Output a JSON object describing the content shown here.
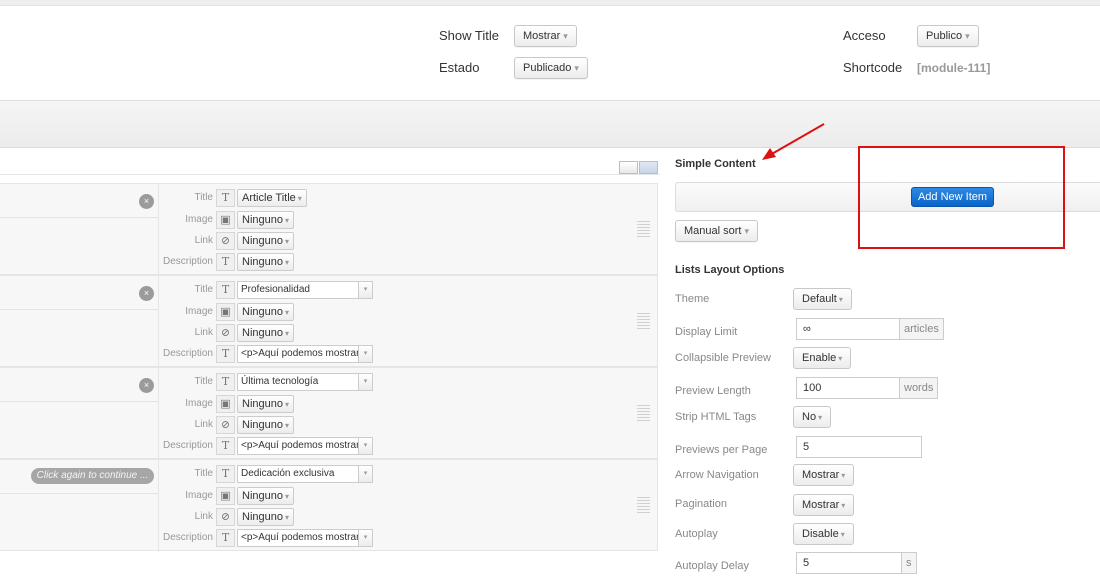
{
  "header": {
    "show_title_label": "Show Title",
    "show_title_value": "Mostrar",
    "estado_label": "Estado",
    "estado_value": "Publicado",
    "acceso_label": "Acceso",
    "acceso_value": "Publico",
    "shortcode_label": "Shortcode",
    "shortcode_value": "[module-111]"
  },
  "items": [
    {
      "action": "close",
      "action_label": "×",
      "title_label": "Title",
      "title_value": "Article Title",
      "title_kind": "select",
      "image_label": "Image",
      "image_value": "Ninguno",
      "link_label": "Link",
      "link_value": "Ninguno",
      "description_label": "Description",
      "description_value": "Ninguno",
      "description_kind": "select"
    },
    {
      "action": "close",
      "action_label": "×",
      "title_label": "Title",
      "title_value": "Profesionalidad",
      "title_kind": "input",
      "image_label": "Image",
      "image_value": "Ninguno",
      "link_label": "Link",
      "link_value": "Ninguno",
      "description_label": "Description",
      "description_value": "<p>Aquí podemos mostrar u",
      "description_kind": "input"
    },
    {
      "action": "close",
      "action_label": "×",
      "title_label": "Title",
      "title_value": "Última tecnología",
      "title_kind": "input",
      "image_label": "Image",
      "image_value": "Ninguno",
      "link_label": "Link",
      "link_value": "Ninguno",
      "description_label": "Description",
      "description_value": "<p>Aquí podemos mostrar u",
      "description_kind": "input"
    },
    {
      "action": "confirm",
      "action_label": "Click again to continue ...",
      "title_label": "Title",
      "title_value": "Dedicación exclusiva",
      "title_kind": "input",
      "image_label": "Image",
      "image_value": "Ninguno",
      "link_label": "Link",
      "link_value": "Ninguno",
      "description_label": "Description",
      "description_value": "<p>Aquí podemos mostrar u",
      "description_kind": "input"
    }
  ],
  "right_panel": {
    "simple_content_title": "Simple Content",
    "add_new_item_label": "Add New Item",
    "manual_sort_label": "Manual sort",
    "lists_layout_title": "Lists Layout Options",
    "options": {
      "theme": {
        "label": "Theme",
        "value": "Default"
      },
      "display_limit": {
        "label": "Display Limit",
        "value": "∞",
        "addon": "articles"
      },
      "collapsible_preview": {
        "label": "Collapsible Preview",
        "value": "Enable"
      },
      "preview_length": {
        "label": "Preview Length",
        "value": "100",
        "addon": "words"
      },
      "strip_html_tags": {
        "label": "Strip HTML Tags",
        "value": "No"
      },
      "previews_per_page": {
        "label": "Previews per Page",
        "value": "5"
      },
      "arrow_navigation": {
        "label": "Arrow Navigation",
        "value": "Mostrar"
      },
      "pagination": {
        "label": "Pagination",
        "value": "Mostrar"
      },
      "autoplay": {
        "label": "Autoplay",
        "value": "Disable"
      },
      "autoplay_delay": {
        "label": "Autoplay Delay",
        "value": "5",
        "addon": "s"
      }
    }
  },
  "colors": {
    "primary_button": "#0b63c8",
    "annotation_red": "#dd1111"
  },
  "icons": {
    "title": "text-T-icon",
    "image": "image-icon",
    "link": "link-chain-icon",
    "close": "close-icon",
    "grip": "drag-handle-icon"
  }
}
